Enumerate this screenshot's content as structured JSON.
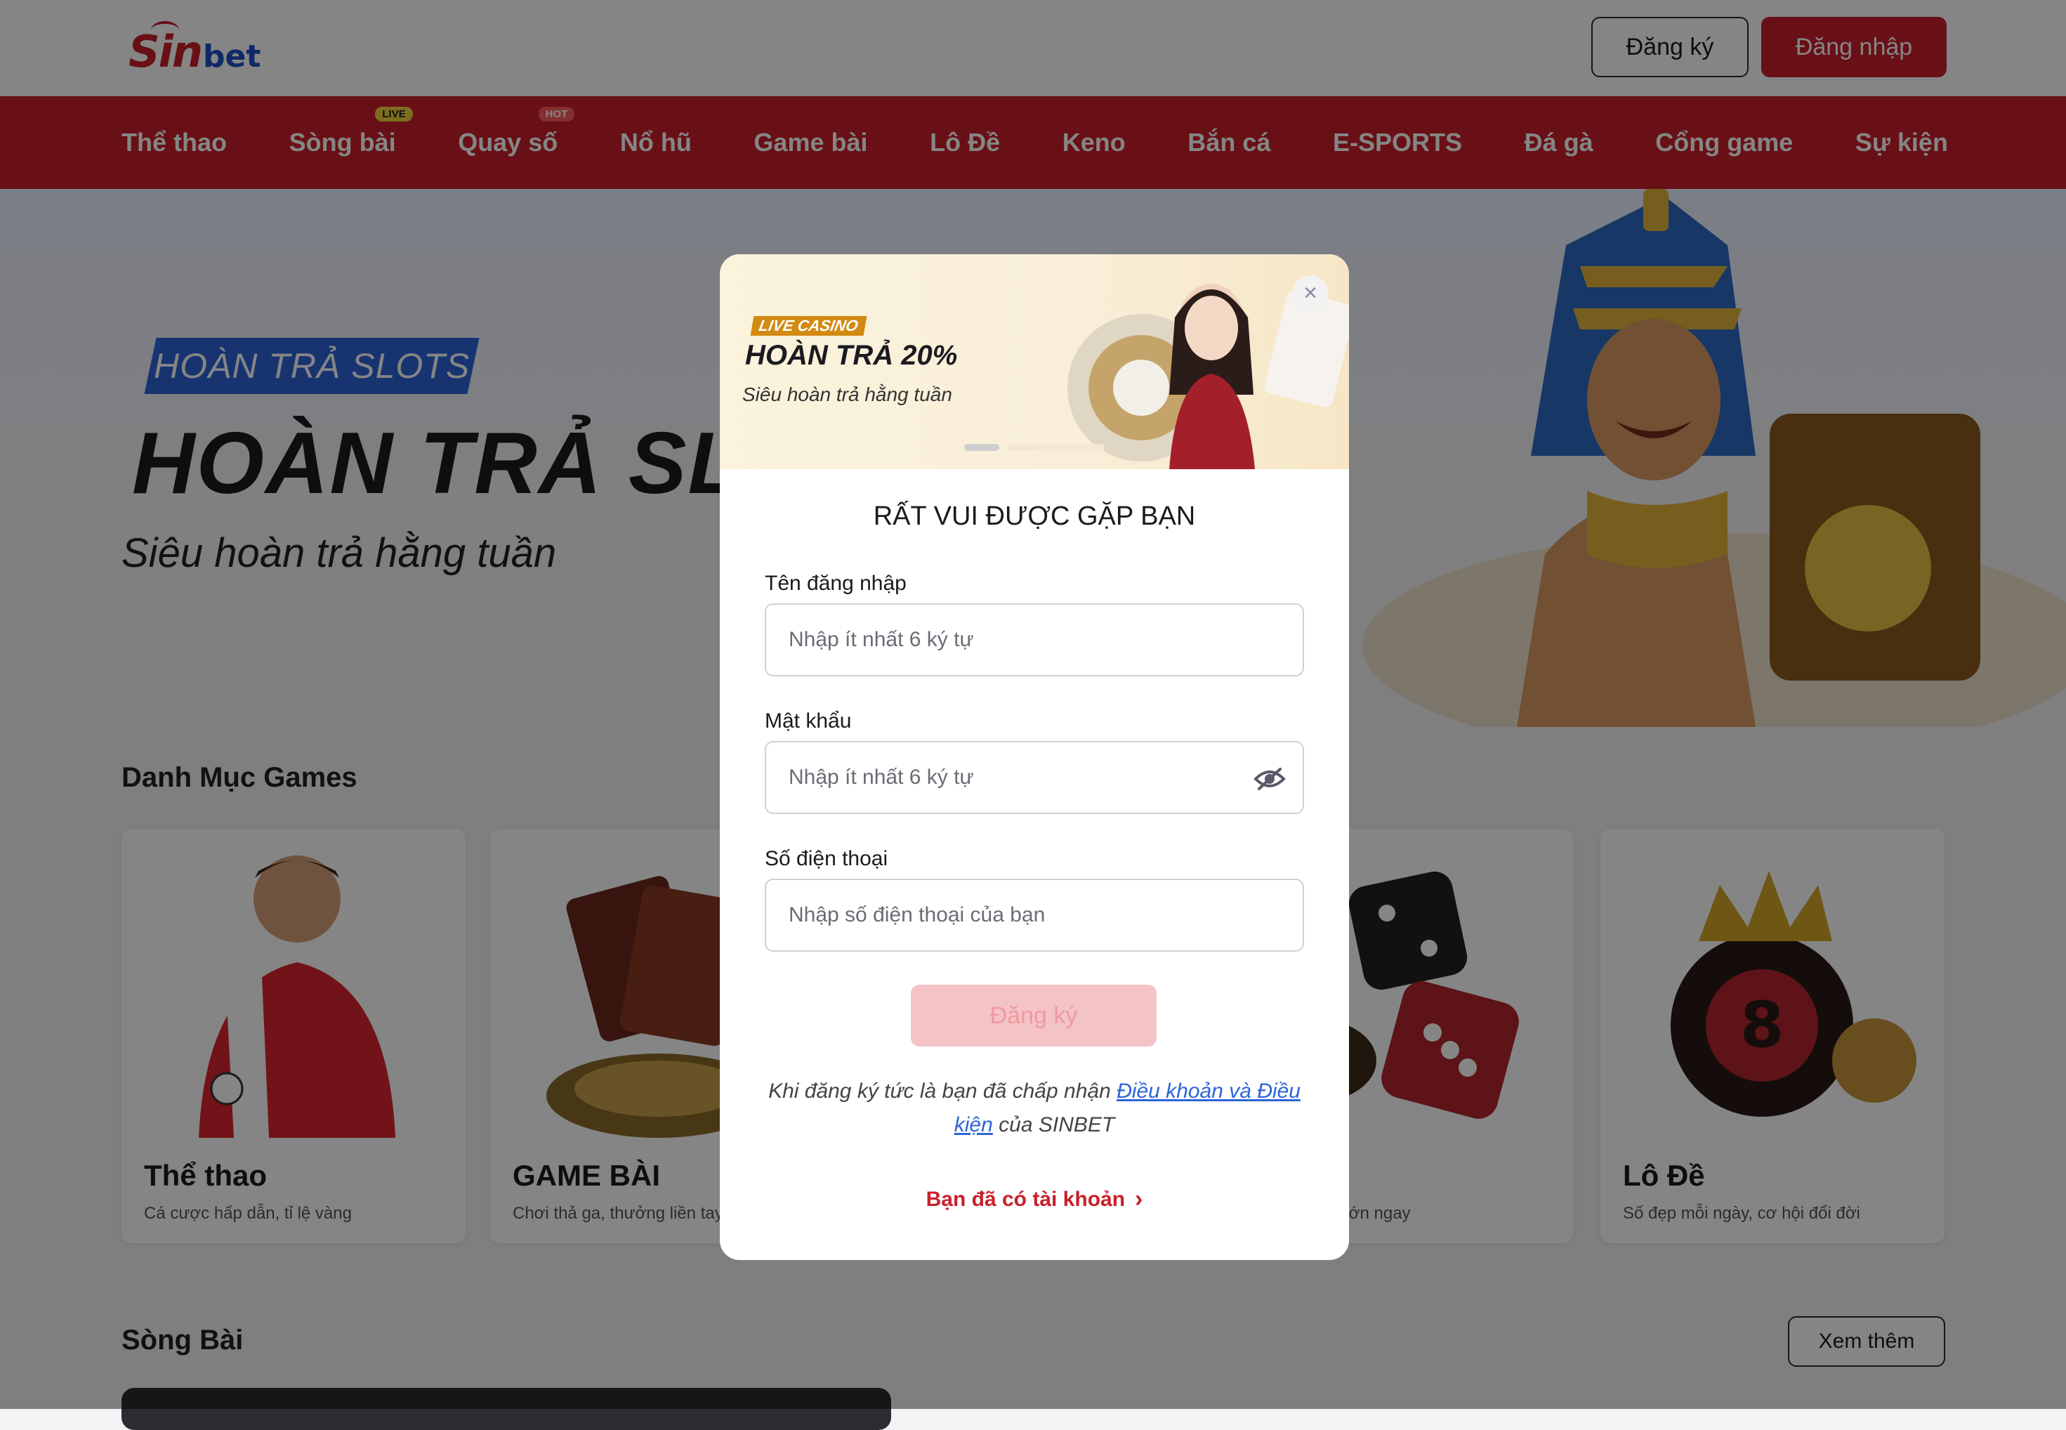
{
  "header": {
    "logo_sin": "Sin",
    "logo_bet": "bet",
    "register_label": "Đăng ký",
    "login_label": "Đăng nhập"
  },
  "nav": {
    "items": [
      {
        "label": "Thể thao"
      },
      {
        "label": "Sòng bài",
        "badge": "LIVE"
      },
      {
        "label": "Quay số",
        "badge": "HOT"
      },
      {
        "label": "Nổ hũ"
      },
      {
        "label": "Game bài"
      },
      {
        "label": "Lô Đề"
      },
      {
        "label": "Keno"
      },
      {
        "label": "Bắn cá"
      },
      {
        "label": "E-SPORTS"
      },
      {
        "label": "Đá gà"
      },
      {
        "label": "Cổng game"
      },
      {
        "label": "Sự kiện"
      }
    ]
  },
  "hero": {
    "tag": "HOÀN TRẢ SLOTS",
    "title": "HOÀN TRẢ SLOTS",
    "subtitle": "Siêu hoàn trả hằng tuần"
  },
  "categories": {
    "title": "Danh Mục Games",
    "cards": [
      {
        "title": "Thể thao",
        "desc": "Cá cược hấp dẫn, tỉ lệ vàng"
      },
      {
        "title": "GAME BÀI",
        "desc": "Chơi thả ga, thưởng liền tay"
      },
      {
        "title": "",
        "desc": ""
      },
      {
        "title": "",
        "desc": "... ăn, thắng lớn ngay"
      },
      {
        "title": "Lô Đề",
        "desc": "Số đẹp mỗi ngày, cơ hội đổi đời"
      }
    ]
  },
  "casino": {
    "title": "Sòng Bài",
    "more_label": "Xem thêm"
  },
  "modal": {
    "banner": {
      "tag": "LIVE CASINO",
      "title": "HOÀN TRẢ 20%",
      "subtitle": "Siêu hoàn trả hằng tuần"
    },
    "close_symbol": "×",
    "heading": "RẤT VUI ĐƯỢC GẶP BẠN",
    "username": {
      "label": "Tên đăng nhập",
      "placeholder": "Nhập ít nhất 6 ký tự"
    },
    "password": {
      "label": "Mật khẩu",
      "placeholder": "Nhập ít nhất 6 ký tự"
    },
    "phone": {
      "label": "Số điện thoại",
      "placeholder": "Nhập số điện thoại của bạn"
    },
    "submit_label": "Đăng ký",
    "terms_prefix": "Khi đăng ký tức là bạn đã chấp nhận",
    "terms_link": "Điều khoản và Điều kiện",
    "terms_suffix": "của SINBET",
    "have_account": "Bạn đã có tài khoản",
    "chevron": "›"
  },
  "colors": {
    "brand_red": "#c8202b",
    "brand_blue": "#2d64d8",
    "submit_disabled": "#f3c3c6"
  }
}
